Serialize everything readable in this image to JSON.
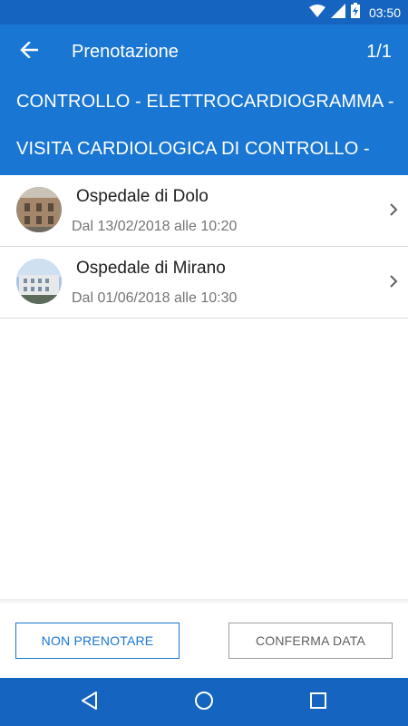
{
  "status_bar": {
    "time": "03:50",
    "icons": [
      "wifi-icon",
      "signal-icon",
      "battery-charging-icon"
    ]
  },
  "app_bar": {
    "back_icon": "arrow-back-icon",
    "title": "Prenotazione",
    "counter": "1/1"
  },
  "prestazioni": [
    "CONTROLLO - ELETTROCARDIOGRAMMA -",
    "VISITA CARDIOLOGICA DI CONTROLLO -"
  ],
  "hospitals": [
    {
      "name": "Ospedale di Dolo",
      "date": "Dal 13/02/2018 alle 10:20"
    },
    {
      "name": "Ospedale di Mirano",
      "date": "Dal 01/06/2018 alle 10:30"
    }
  ],
  "buttons": {
    "non_prenotare": "NON PRENOTARE",
    "conferma_data": "CONFERMA DATA"
  },
  "nav_bar": {
    "icons": [
      "nav-back-icon",
      "nav-home-icon",
      "nav-recents-icon"
    ]
  },
  "colors": {
    "primary": "#1976d2",
    "primary_dark": "#1565c0"
  }
}
